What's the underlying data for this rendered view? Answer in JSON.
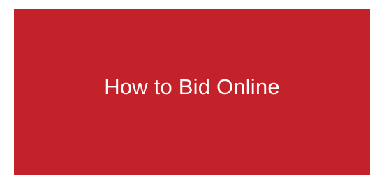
{
  "banner": {
    "label": "How to Bid Online",
    "background_color": "#c4222b",
    "text_color": "#ffffff"
  }
}
